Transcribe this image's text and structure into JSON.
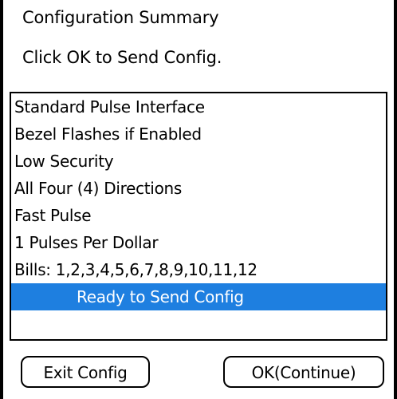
{
  "header": {
    "title": "Configuration Summary",
    "instruction": "Click OK to Send Config."
  },
  "summary_list": {
    "items": [
      "Standard Pulse Interface",
      "Bezel Flashes if Enabled",
      "Low Security",
      "All Four (4) Directions",
      "Fast Pulse",
      "1 Pulses Per Dollar",
      "Bills: 1,2,3,4,5,6,7,8,9,10,11,12",
      "Ready to Send Config"
    ],
    "selected_index": 7
  },
  "buttons": {
    "exit_label": "Exit Config",
    "ok_label": "OK(Continue)"
  },
  "colors": {
    "selection": "#1e7fe0",
    "selection_text": "#ffffff",
    "border": "#000000"
  }
}
